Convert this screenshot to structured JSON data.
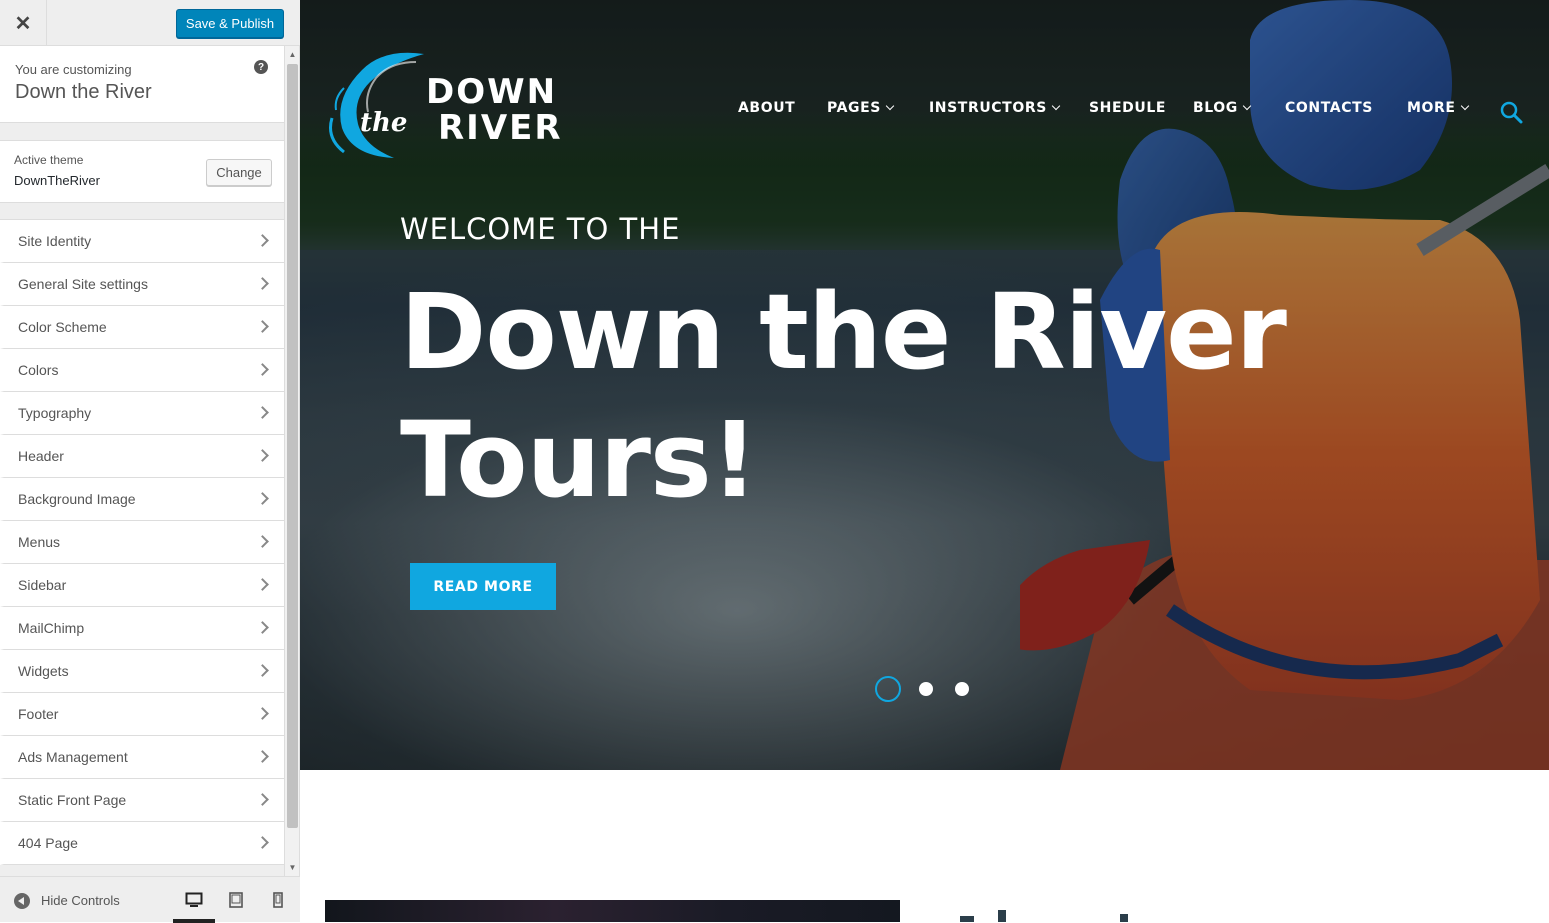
{
  "customizer": {
    "close_label": "✕",
    "save_label": "Save & Publish",
    "customizing_label": "You are customizing",
    "site_name": "Down the River",
    "help_label": "?",
    "active_theme_label": "Active theme",
    "theme_name": "DownTheRiver",
    "change_label": "Change",
    "sections": [
      {
        "label": "Site Identity"
      },
      {
        "label": "General Site settings"
      },
      {
        "label": "Color Scheme"
      },
      {
        "label": "Colors"
      },
      {
        "label": "Typography"
      },
      {
        "label": "Header"
      },
      {
        "label": "Background Image"
      },
      {
        "label": "Menus"
      },
      {
        "label": "Sidebar"
      },
      {
        "label": "MailChimp"
      },
      {
        "label": "Widgets"
      },
      {
        "label": "Footer"
      },
      {
        "label": "Ads Management"
      },
      {
        "label": "Static Front Page"
      },
      {
        "label": "404 Page"
      }
    ],
    "hide_controls_label": "Hide Controls",
    "device_icons": [
      "desktop-icon",
      "tablet-icon",
      "mobile-icon"
    ],
    "active_device": "desktop"
  },
  "site": {
    "logo": {
      "line1": "DOWN",
      "line2": "RIVER",
      "script": "the"
    },
    "nav": [
      {
        "label": "ABOUT",
        "dropdown": false
      },
      {
        "label": "PAGES",
        "dropdown": true
      },
      {
        "label": "INSTRUCTORS",
        "dropdown": true
      },
      {
        "label": "SHEDULE",
        "dropdown": false
      },
      {
        "label": "BLOG",
        "dropdown": true
      },
      {
        "label": "CONTACTS",
        "dropdown": false
      },
      {
        "label": "MORE",
        "dropdown": true
      }
    ],
    "hero": {
      "kicker": "WELCOME TO THE",
      "title_line1": "Down the River",
      "title_line2": "Tours!",
      "cta_label": "READ MORE",
      "slides": 3,
      "active_slide": 1
    },
    "colors": {
      "accent": "#10a7e0",
      "button_primary": "#0085ba"
    }
  }
}
